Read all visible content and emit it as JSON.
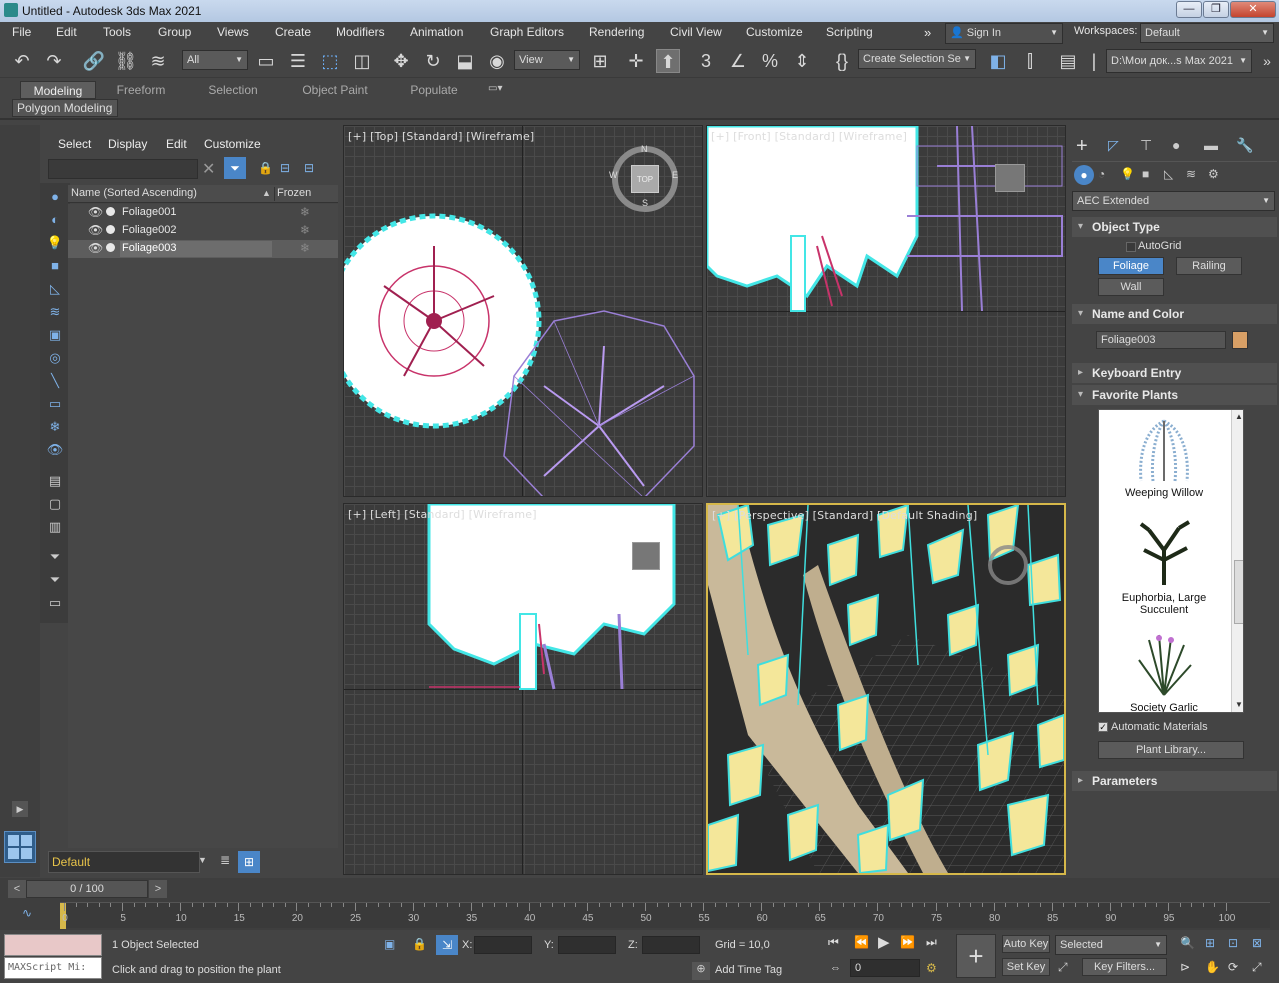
{
  "window": {
    "title": "Untitled - Autodesk 3ds Max 2021",
    "min": "—",
    "max": "❐",
    "close": "✕"
  },
  "menu": [
    "File",
    "Edit",
    "Tools",
    "Group",
    "Views",
    "Create",
    "Modifiers",
    "Animation",
    "Graph Editors",
    "Rendering",
    "Civil View",
    "Customize",
    "Scripting"
  ],
  "menu_more": "»",
  "account": {
    "label": "Sign In",
    "workspaces_label": "Workspaces:",
    "workspace": "Default"
  },
  "toolbar": {
    "filter": "All",
    "ref_coord": "View",
    "selection_set": "Create Selection Se",
    "path": "D:\\Мои док...s Max 2021"
  },
  "ribbon": {
    "tabs": [
      "Modeling",
      "Freeform",
      "Selection",
      "Object Paint",
      "Populate"
    ],
    "active": "Modeling",
    "subpanel": "Polygon Modeling"
  },
  "scene_explorer": {
    "menu": [
      "Select",
      "Display",
      "Edit",
      "Customize"
    ],
    "col_name": "Name (Sorted Ascending)",
    "col_sort_arrow": "▲",
    "col_frozen": "Frozen",
    "items": [
      "Foliage001",
      "Foliage002",
      "Foliage003"
    ],
    "selected_index": 2,
    "layer": "Default"
  },
  "viewports": {
    "top": "[+] [Top] [Standard] [Wireframe]",
    "front": "[+] [Front] [Standard] [Wireframe]",
    "left": "[+] [Left] [Standard] [Wireframe]",
    "persp": "[+] [Perspective] [Standard] [Default Shading]",
    "compass": {
      "n": "N",
      "s": "S",
      "e": "E",
      "w": "W",
      "center": "TOP"
    }
  },
  "command_panel": {
    "category": "AEC Extended",
    "object_type": "Object Type",
    "autogrid": "AutoGrid",
    "buttons": [
      "Foliage",
      "Railing",
      "Wall"
    ],
    "name_color": "Name and Color",
    "object_name": "Foliage003",
    "color": "#d9a066",
    "keyboard_entry": "Keyboard Entry",
    "favorite_plants": "Favorite Plants",
    "plants": [
      "Weeping Willow",
      "Euphorbia, Large\nSucculent",
      "Society Garlic"
    ],
    "auto_materials": "Automatic Materials",
    "plant_library": "Plant Library...",
    "parameters": "Parameters"
  },
  "timeline": {
    "frame": "0 / 100",
    "prev": "<",
    "next": ">",
    "ticks": [
      "0",
      "5",
      "10",
      "15",
      "20",
      "25",
      "30",
      "35",
      "40",
      "45",
      "50",
      "55",
      "60",
      "65",
      "70",
      "75",
      "80",
      "85",
      "90",
      "95",
      "100"
    ]
  },
  "status": {
    "maxscript": "MAXScript Mi:",
    "selected": "1 Object Selected",
    "prompt": "Click and drag to position the plant",
    "x_label": "X:",
    "y_label": "Y:",
    "z_label": "Z:",
    "grid": "Grid = 10,0",
    "add_time_tag": "Add Time Tag",
    "auto_key": "Auto Key",
    "set_key": "Set Key",
    "selected_dd": "Selected",
    "key_filters": "Key Filters...",
    "frame_field": "0"
  }
}
